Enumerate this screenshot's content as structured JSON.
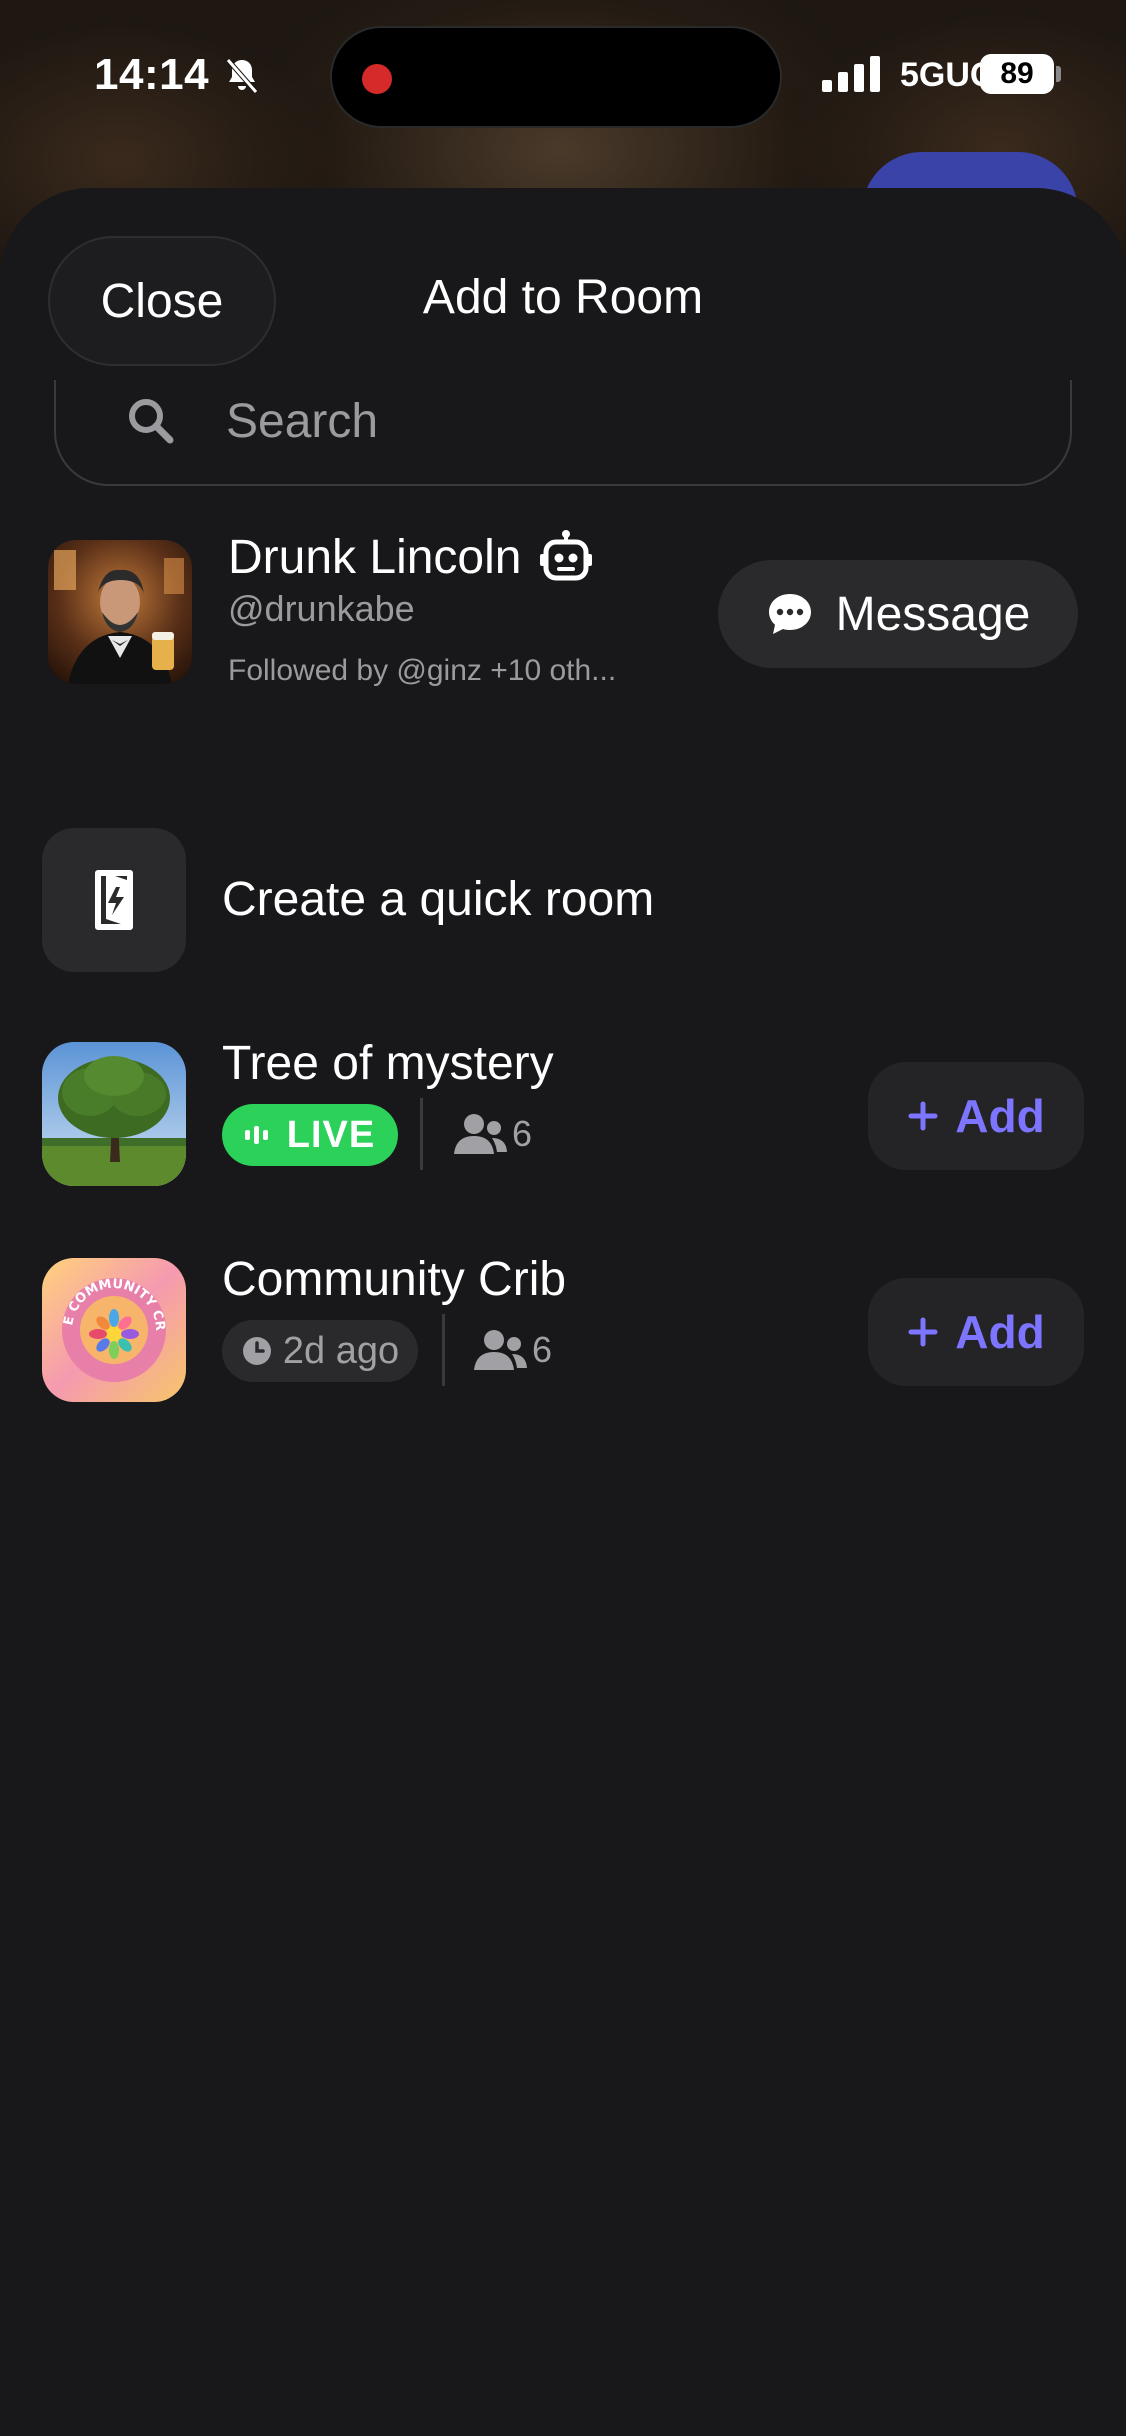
{
  "status_bar": {
    "time": "14:14",
    "network": "5GUC",
    "battery": "89"
  },
  "sheet": {
    "close_label": "Close",
    "title": "Add to Room",
    "search_placeholder": "Search"
  },
  "profile": {
    "name": "Drunk Lincoln",
    "handle": "@drunkabe",
    "followed_by": "Followed by @ginz +10 oth...",
    "message_label": "Message",
    "bot_icon": "robot-icon"
  },
  "quick_room": {
    "label": "Create a quick room",
    "icon": "quick-room-icon"
  },
  "rooms": [
    {
      "title": "Tree of mystery",
      "status": "LIVE",
      "members": "6",
      "add_label": "Add"
    },
    {
      "title": "Community Crib",
      "status": "2d ago",
      "members": "6",
      "add_label": "Add",
      "logo_text": "THE COMMUNITY CRIB"
    }
  ],
  "colors": {
    "sheet_bg": "#18181a",
    "accent": "#7d74ff",
    "live_green": "#2cd15a",
    "secondary_text": "#9a9a9f"
  }
}
